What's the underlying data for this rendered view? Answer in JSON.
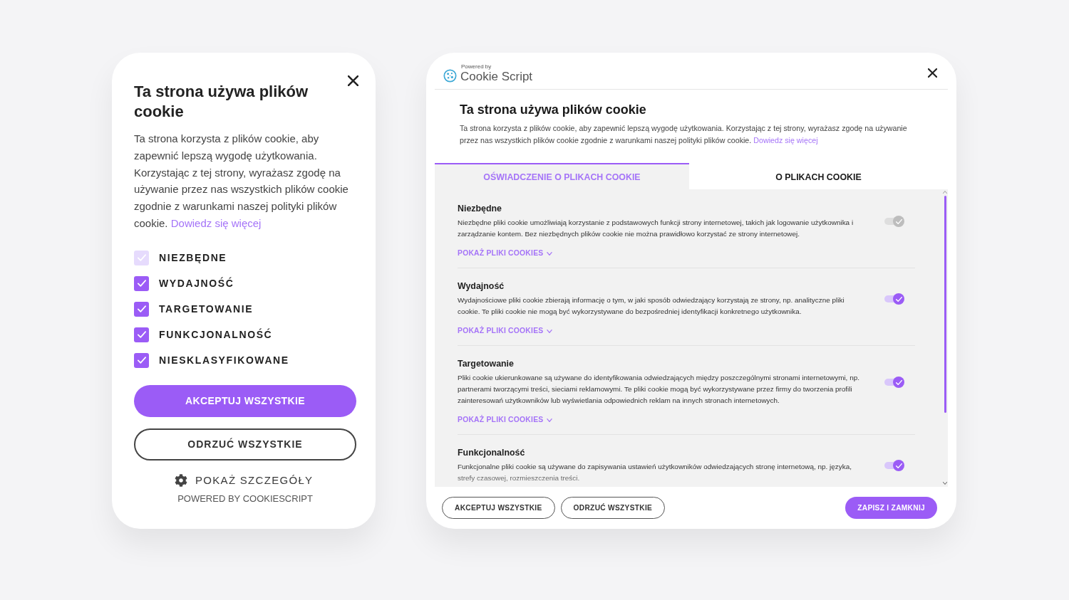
{
  "left_banner": {
    "title": "Ta strona używa plików cookie",
    "description": "Ta strona korzysta z plików cookie, aby zapewnić lepszą wygodę użytkowania. Korzystając z tej strony, wyrażasz zgodę na używanie przez nas wszystkich plików cookie zgodnie z warunkami naszej polityki plików cookie.",
    "learn_more_link": "Dowiedz się więcej",
    "categories": [
      {
        "label": "NIEZBĘDNE",
        "checked": true,
        "disabled": true
      },
      {
        "label": "WYDAJNOŚĆ",
        "checked": true,
        "disabled": false
      },
      {
        "label": "TARGETOWANIE",
        "checked": true,
        "disabled": false
      },
      {
        "label": "FUNKCJONALNOŚĆ",
        "checked": true,
        "disabled": false
      },
      {
        "label": "NIESKLASYFIKOWANE",
        "checked": true,
        "disabled": false
      }
    ],
    "accept_button": "AKCEPTUJ WSZYSTKIE",
    "reject_button": "ODRZUĆ WSZYSTKIE",
    "details_link": "POKAŻ SZCZEGÓŁY",
    "powered_by": "POWERED BY COOKIESCRIPT"
  },
  "right_panel": {
    "logo": {
      "caption": "Powered by",
      "name": "Cookie Script"
    },
    "title": "Ta strona używa plików cookie",
    "description": "Ta strona korzysta z plików cookie, aby zapewnić lepszą wygodę użytkowania. Korzystając z tej strony, wyrażasz zgodę na używanie przez nas wszystkich plików cookie zgodnie z warunkami naszej polityki plików cookie.",
    "learn_more_link": "Dowiedz się więcej",
    "tabs": [
      {
        "label": "OŚWIADCZENIE O PLIKACH COOKIE",
        "selected": true
      },
      {
        "label": "O PLIKACH COOKIE",
        "selected": false
      }
    ],
    "categories": [
      {
        "name": "Niezbędne",
        "description": "Niezbędne pliki cookie umożliwiają korzystanie z podstawowych funkcji strony internetowej, takich jak logowanie użytkownika i zarządzanie kontem. Bez niezbędnych plików cookie nie można prawidłowo korzystać ze strony internetowej.",
        "on": true,
        "disabled": true,
        "link": "POKAŻ PLIKI COOKIES"
      },
      {
        "name": "Wydajność",
        "description": "Wydajnościowe pliki cookie zbierają informację o tym, w jaki sposób odwiedzający korzystają ze strony, np. analityczne pliki cookie. Te pliki cookie nie mogą być wykorzystywane do bezpośredniej identyfikacji konkretnego użytkownika.",
        "on": true,
        "disabled": false,
        "link": "POKAŻ PLIKI COOKIES"
      },
      {
        "name": "Targetowanie",
        "description": "Pliki cookie ukierunkowane są używane do identyfikowania odwiedzających między poszczególnymi stronami internetowymi, np. partnerami tworzącymi treści, sieciami reklamowymi. Te pliki cookie mogą być wykorzystywane przez firmy do tworzenia profili zainteresowań użytkowników lub wyświetlania odpowiednich reklam na innych stronach internetowych.",
        "on": true,
        "disabled": false,
        "link": "POKAŻ PLIKI COOKIES"
      },
      {
        "name": "Funkcjonalność",
        "description": "Funkcjonalne pliki cookie są używane do zapisywania ustawień użytkowników odwiedzających stronę internetową, np. języka, strefy czasowej, rozmieszczenia treści.",
        "on": true,
        "disabled": false
      }
    ],
    "buttons": [
      {
        "label": "AKCEPTUJ WSZYSTKIE",
        "kind": "outline"
      },
      {
        "label": "ODRZUĆ WSZYSTKIE",
        "kind": "outline"
      },
      {
        "label": "ZAPISZ I ZAMKNIJ",
        "kind": "primary"
      }
    ]
  }
}
